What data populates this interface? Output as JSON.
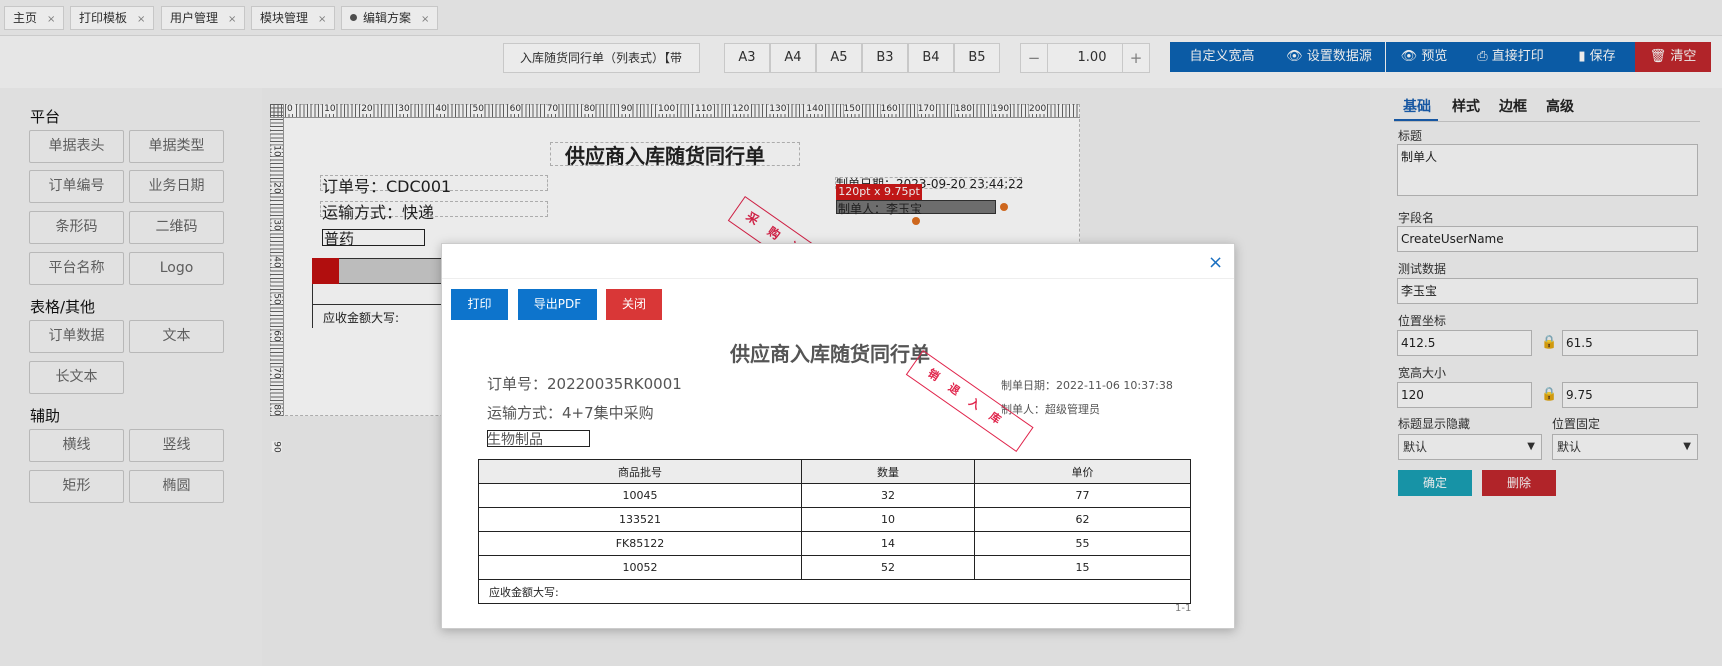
{
  "tabs": [
    {
      "label": "主页",
      "close": "×"
    },
    {
      "label": "打印模板",
      "close": "×"
    },
    {
      "label": "用户管理",
      "close": "×"
    },
    {
      "label": "模块管理",
      "close": "×"
    },
    {
      "label": "编辑方案",
      "close": "×"
    }
  ],
  "toolbar": {
    "template_select": "入库随货同行单（列表式）【带",
    "paper_sizes": [
      "A3",
      "A4",
      "A5",
      "B3",
      "B4",
      "B5"
    ],
    "zoom_minus": "−",
    "zoom_value": "1.00",
    "zoom_plus": "+",
    "custom_size": "自定义宽高",
    "set_datasource": "设置数据源",
    "preview": "预览",
    "direct_print": "直接打印",
    "save": "保存",
    "clear": "清空"
  },
  "left_panel": {
    "groups": [
      {
        "title": "平台",
        "items": [
          "单据表头",
          "单据类型",
          "订单编号",
          "业务日期",
          "条形码",
          "二维码",
          "平台名称",
          "Logo"
        ]
      },
      {
        "title": "表格/其他",
        "items": [
          "订单数据",
          "文本",
          "长文本"
        ]
      },
      {
        "title": "辅助",
        "items": [
          "横线",
          "竖线",
          "矩形",
          "椭圆"
        ]
      }
    ]
  },
  "design": {
    "ruler_h": [
      "0",
      "10",
      "20",
      "30",
      "40",
      "50",
      "60",
      "70",
      "80",
      "90",
      "100",
      "110",
      "120",
      "130",
      "140",
      "150",
      "160",
      "170",
      "180",
      "190",
      "200"
    ],
    "ruler_v": [
      "10",
      "20",
      "30",
      "40",
      "50",
      "60",
      "70",
      "80",
      "90"
    ],
    "title": "供应商入库随货同行单",
    "order_no": "订单号：CDC001",
    "transport": "运输方式：快递",
    "category": "普药",
    "stamp": "采购订单",
    "make_date": "制单日期：2023-09-20 23:44:22",
    "size_tip": "120pt x 9.75pt",
    "maker": "制单人：李玉宝",
    "amount": "应收金额大写:"
  },
  "right_panel": {
    "tabs": [
      "基础",
      "样式",
      "边框",
      "高级"
    ],
    "title_label": "标题",
    "title_value": "制单人",
    "field_label": "字段名",
    "field_value": "CreateUserName",
    "test_label": "测试数据",
    "test_value": "李玉宝",
    "pos_label": "位置坐标",
    "pos_x": "412.5",
    "pos_y": "61.5",
    "size_label": "宽高大小",
    "width": "120",
    "height": "9.75",
    "show_label": "标题显示隐藏",
    "show_value": "默认",
    "fixed_label": "位置固定",
    "fixed_value": "默认",
    "confirm": "确定",
    "delete": "删除"
  },
  "modal": {
    "close": "×",
    "print": "打印",
    "export_pdf": "导出PDF",
    "close_btn": "关闭",
    "title": "供应商入库随货同行单",
    "order_no": "订单号：20220035RK0001",
    "transport": "运输方式：4+7集中采购",
    "category": "生物制品",
    "make_date": "制单日期：2022-11-06 10:37:38",
    "maker": "制单人：超级管理员",
    "stamp": "销退入库",
    "columns": [
      "商品批号",
      "数量",
      "单价"
    ],
    "rows": [
      [
        "10045",
        "32",
        "77"
      ],
      [
        "133521",
        "10",
        "62"
      ],
      [
        "FK85122",
        "14",
        "55"
      ],
      [
        "10052",
        "52",
        "15"
      ]
    ],
    "amount": "应收金额大写:",
    "page": "1-1"
  }
}
